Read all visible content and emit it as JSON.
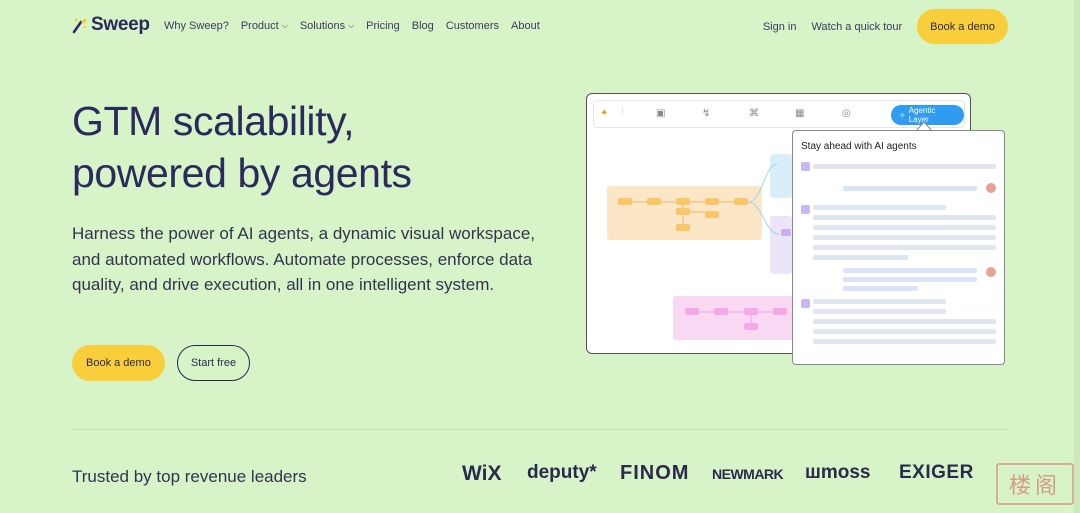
{
  "brand": {
    "name": "Sweep"
  },
  "nav": {
    "links": [
      {
        "label": "Why Sweep?"
      },
      {
        "label": "Product",
        "has_menu": true
      },
      {
        "label": "Solutions",
        "has_menu": true
      },
      {
        "label": "Pricing"
      },
      {
        "label": "Blog"
      },
      {
        "label": "Customers"
      },
      {
        "label": "About"
      }
    ],
    "sign_in": "Sign in",
    "quick_tour": "Watch a quick tour",
    "book_demo": "Book a demo"
  },
  "hero": {
    "title_line1": "GTM scalability,",
    "title_line2": "powered by agents",
    "subtitle": "Harness the power of AI agents, a dynamic visual workspace, and automated workflows. Automate processes, enforce data quality, and drive execution, all in one intelligent system.",
    "cta_primary": "Book a demo",
    "cta_secondary": "Start free"
  },
  "mockup": {
    "agentic_button": "Agentic Layer",
    "panel_title": "Stay ahead with AI agents"
  },
  "trusted": {
    "heading": "Trusted by top revenue leaders",
    "logos": [
      "WiX",
      "deputy*",
      "FINOM",
      "NEWMARK",
      "moss",
      "EXIGER"
    ]
  },
  "watermark": {
    "text": "楼阁"
  },
  "colors": {
    "background": "#d7f4c8",
    "accent_yellow": "#f8cf3a",
    "text_dark": "#2b2a5c",
    "agentic_blue": "#2f9cf2"
  }
}
